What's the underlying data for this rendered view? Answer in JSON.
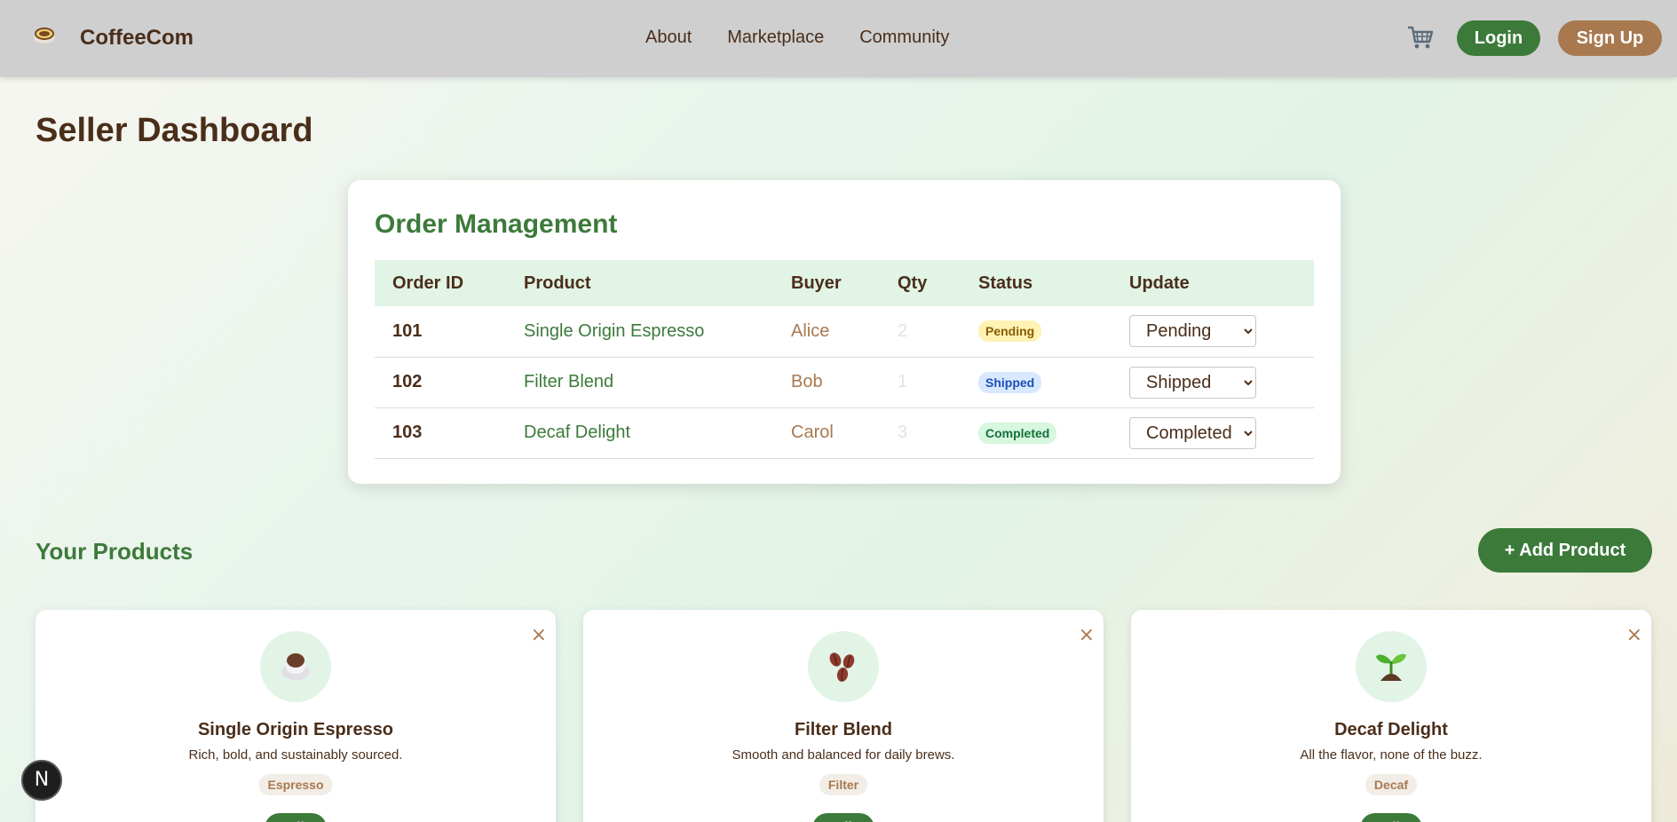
{
  "header": {
    "brand": "CoffeeCom",
    "nav": [
      "About",
      "Marketplace",
      "Community"
    ],
    "login_label": "Login",
    "signup_label": "Sign Up"
  },
  "page": {
    "title": "Seller Dashboard"
  },
  "orders": {
    "title": "Order Management",
    "columns": [
      "Order ID",
      "Product",
      "Buyer",
      "Qty",
      "Status",
      "Update"
    ],
    "rows": [
      {
        "id": "101",
        "product": "Single Origin Espresso",
        "buyer": "Alice",
        "qty": "2",
        "status": "Pending",
        "update": "Pending"
      },
      {
        "id": "102",
        "product": "Filter Blend",
        "buyer": "Bob",
        "qty": "1",
        "status": "Shipped",
        "update": "Shipped"
      },
      {
        "id": "103",
        "product": "Decaf Delight",
        "buyer": "Carol",
        "qty": "3",
        "status": "Completed",
        "update": "Completed"
      }
    ],
    "status_options": [
      "Pending",
      "Shipped",
      "Completed"
    ]
  },
  "products": {
    "title": "Your Products",
    "add_label": "+ Add Product",
    "close_glyph": "×",
    "edit_label": "Edit",
    "items": [
      {
        "name": "Single Origin Espresso",
        "desc": "Rich, bold, and sustainably sourced.",
        "tag": "Espresso",
        "icon": "coffee-cup-icon"
      },
      {
        "name": "Filter Blend",
        "desc": "Smooth and balanced for daily brews.",
        "tag": "Filter",
        "icon": "coffee-beans-icon"
      },
      {
        "name": "Decaf Delight",
        "desc": "All the flavor, none of the buzz.",
        "tag": "Decaf",
        "icon": "seedling-icon"
      }
    ]
  },
  "dev_badge": {
    "label": "N"
  },
  "colors": {
    "primary_green": "#3c7a3a",
    "brown_accent": "#a8794f",
    "text_brown": "#4a2e1a",
    "header_bg": "#cfcfcf"
  }
}
